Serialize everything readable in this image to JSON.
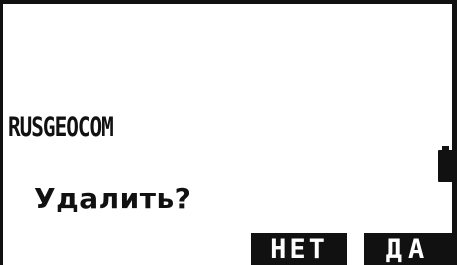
{
  "file": {
    "name": "RUSGEOCOM"
  },
  "dialog": {
    "prompt": "Удалить?"
  },
  "softkeys": {
    "no_label": "НЕТ",
    "yes_label": "ДА"
  },
  "status": {
    "battery_icon": "battery-icon"
  }
}
